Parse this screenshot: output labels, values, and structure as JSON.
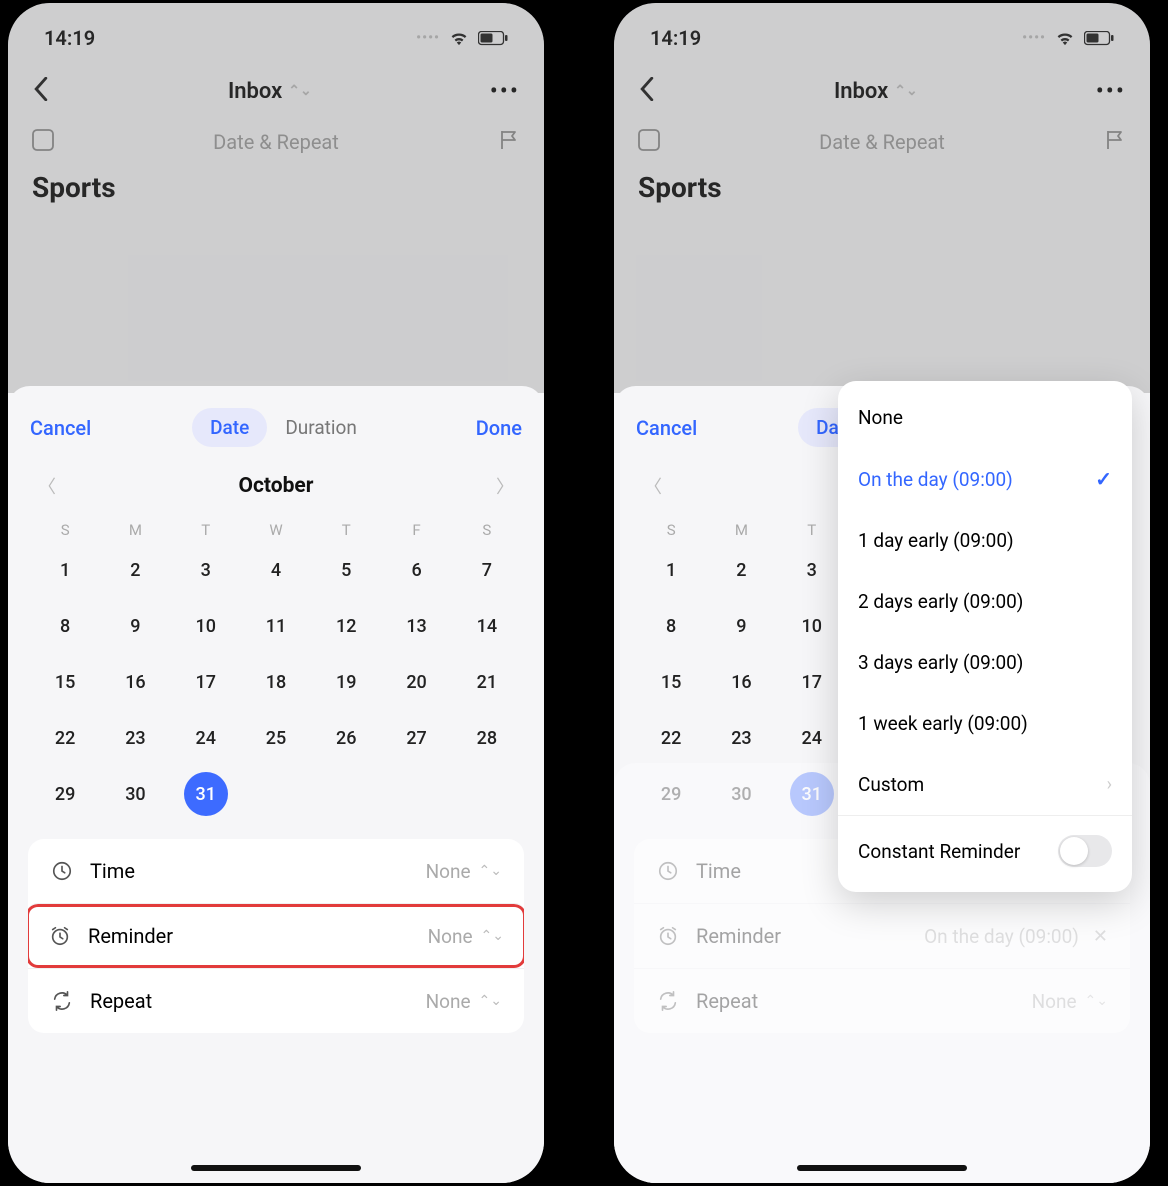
{
  "status": {
    "time": "14:19"
  },
  "nav": {
    "title": "Inbox"
  },
  "subheader": {
    "center": "Date & Repeat"
  },
  "task": {
    "title": "Sports"
  },
  "sheet": {
    "cancel": "Cancel",
    "done": "Done",
    "seg_date": "Date",
    "seg_duration": "Duration",
    "month": "October",
    "weekdays": [
      "S",
      "M",
      "T",
      "W",
      "T",
      "F",
      "S"
    ],
    "days": [
      "1",
      "2",
      "3",
      "4",
      "5",
      "6",
      "7",
      "8",
      "9",
      "10",
      "11",
      "12",
      "13",
      "14",
      "15",
      "16",
      "17",
      "18",
      "19",
      "20",
      "21",
      "22",
      "23",
      "24",
      "25",
      "26",
      "27",
      "28",
      "29",
      "30",
      "31"
    ],
    "selected_day": "31"
  },
  "options": {
    "time_label": "Time",
    "time_value": "None",
    "reminder_label": "Reminder",
    "reminder_value_left": "None",
    "reminder_value_right": "On the day  (09:00)",
    "repeat_label": "Repeat",
    "repeat_value": "None"
  },
  "popover": {
    "none": "None",
    "on_the_day": "On the day  (09:00)",
    "one_day": "1 day early  (09:00)",
    "two_days": "2 days early  (09:00)",
    "three_days": "3 days early  (09:00)",
    "one_week": "1 week early  (09:00)",
    "custom": "Custom",
    "constant": "Constant Reminder"
  }
}
